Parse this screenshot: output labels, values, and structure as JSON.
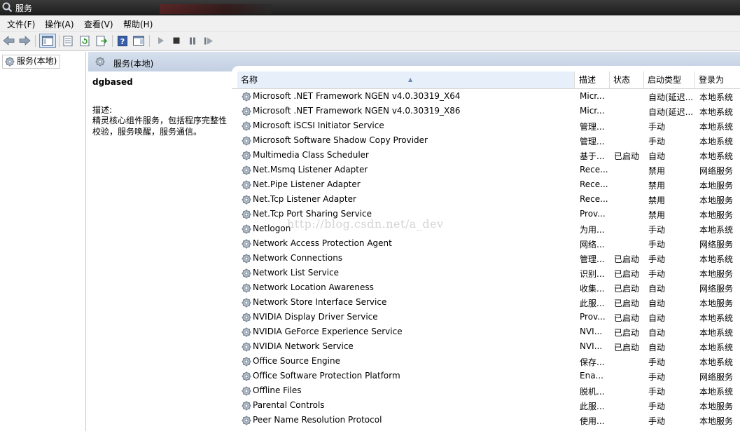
{
  "window": {
    "title": "服务"
  },
  "menu": [
    "文件(F)",
    "操作(A)",
    "查看(V)",
    "帮助(H)"
  ],
  "tree": {
    "root_label": "服务(本地)"
  },
  "header": {
    "label": "服务(本地)"
  },
  "detail": {
    "service_name": "dgbased",
    "description_label": "描述:",
    "description": "精灵核心组件服务，包括程序完整性校验，服务唤醒，服务通信。"
  },
  "columns": {
    "name": "名称",
    "description": "描述",
    "status": "状态",
    "startup": "启动类型",
    "logon": "登录为"
  },
  "services": [
    {
      "name": "Microsoft .NET Framework NGEN v4.0.30319_X64",
      "desc": "Micr...",
      "status": "",
      "startup": "自动(延迟...",
      "logon": "本地系统"
    },
    {
      "name": "Microsoft .NET Framework NGEN v4.0.30319_X86",
      "desc": "Micr...",
      "status": "",
      "startup": "自动(延迟...",
      "logon": "本地系统"
    },
    {
      "name": "Microsoft iSCSI Initiator Service",
      "desc": "管理...",
      "status": "",
      "startup": "手动",
      "logon": "本地系统"
    },
    {
      "name": "Microsoft Software Shadow Copy Provider",
      "desc": "管理...",
      "status": "",
      "startup": "手动",
      "logon": "本地系统"
    },
    {
      "name": "Multimedia Class Scheduler",
      "desc": "基于...",
      "status": "已启动",
      "startup": "自动",
      "logon": "本地系统"
    },
    {
      "name": "Net.Msmq Listener Adapter",
      "desc": "Rece...",
      "status": "",
      "startup": "禁用",
      "logon": "网络服务"
    },
    {
      "name": "Net.Pipe Listener Adapter",
      "desc": "Rece...",
      "status": "",
      "startup": "禁用",
      "logon": "本地服务"
    },
    {
      "name": "Net.Tcp Listener Adapter",
      "desc": "Rece...",
      "status": "",
      "startup": "禁用",
      "logon": "本地服务"
    },
    {
      "name": "Net.Tcp Port Sharing Service",
      "desc": "Prov...",
      "status": "",
      "startup": "禁用",
      "logon": "本地服务"
    },
    {
      "name": "Netlogon",
      "desc": "为用...",
      "status": "",
      "startup": "手动",
      "logon": "本地系统"
    },
    {
      "name": "Network Access Protection Agent",
      "desc": "网络...",
      "status": "",
      "startup": "手动",
      "logon": "网络服务"
    },
    {
      "name": "Network Connections",
      "desc": "管理...",
      "status": "已启动",
      "startup": "手动",
      "logon": "本地系统"
    },
    {
      "name": "Network List Service",
      "desc": "识别...",
      "status": "已启动",
      "startup": "手动",
      "logon": "本地服务"
    },
    {
      "name": "Network Location Awareness",
      "desc": "收集...",
      "status": "已启动",
      "startup": "自动",
      "logon": "网络服务"
    },
    {
      "name": "Network Store Interface Service",
      "desc": "此服...",
      "status": "已启动",
      "startup": "自动",
      "logon": "本地服务"
    },
    {
      "name": "NVIDIA Display Driver Service",
      "desc": "Prov...",
      "status": "已启动",
      "startup": "自动",
      "logon": "本地系统"
    },
    {
      "name": "NVIDIA GeForce Experience Service",
      "desc": "NVI...",
      "status": "已启动",
      "startup": "自动",
      "logon": "本地系统"
    },
    {
      "name": "NVIDIA Network Service",
      "desc": "NVI...",
      "status": "已启动",
      "startup": "自动",
      "logon": "本地系统"
    },
    {
      "name": "Office  Source Engine",
      "desc": "保存...",
      "status": "",
      "startup": "手动",
      "logon": "本地系统"
    },
    {
      "name": "Office Software Protection Platform",
      "desc": "Ena...",
      "status": "",
      "startup": "手动",
      "logon": "网络服务"
    },
    {
      "name": "Offline Files",
      "desc": "脱机...",
      "status": "",
      "startup": "手动",
      "logon": "本地系统"
    },
    {
      "name": "Parental Controls",
      "desc": "此服...",
      "status": "",
      "startup": "手动",
      "logon": "本地服务"
    },
    {
      "name": "Peer Name Resolution Protocol",
      "desc": "使用...",
      "status": "",
      "startup": "手动",
      "logon": "本地服务"
    }
  ],
  "watermark": "http://blog.csdn.net/a_dev"
}
